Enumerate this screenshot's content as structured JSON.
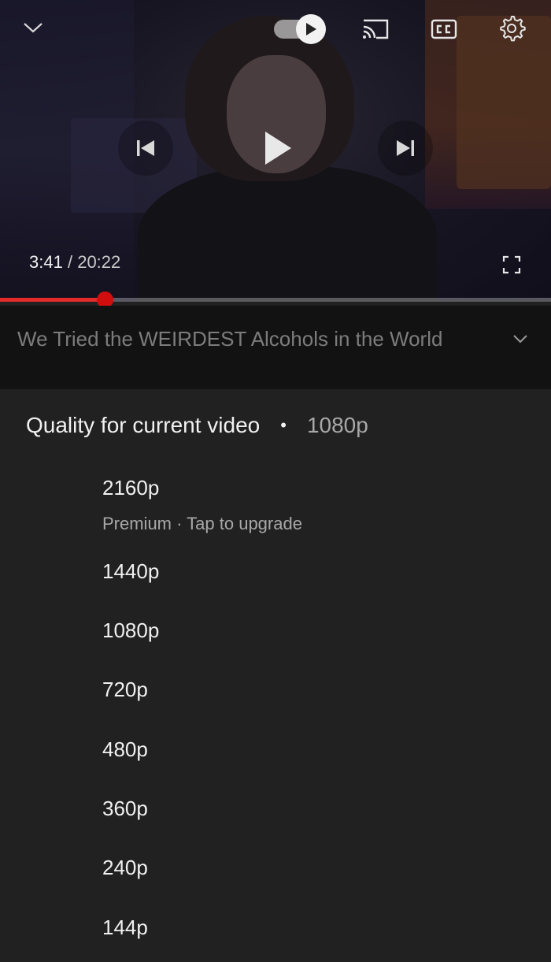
{
  "player": {
    "current_time": "3:41",
    "separator": "/",
    "duration": "20:22",
    "progress_fraction": 0.19,
    "autoplay_on": true,
    "icons": {
      "collapse": "chevron-down-icon",
      "autoplay": "autoplay-toggle-icon",
      "cast": "cast-icon",
      "captions": "closed-captions-icon",
      "settings": "gear-icon",
      "previous": "skip-previous-icon",
      "play": "play-icon",
      "next": "skip-next-icon",
      "fullscreen": "fullscreen-icon"
    },
    "colors": {
      "progress": "#e52a2a",
      "scrubber": "#d10e0e"
    }
  },
  "video": {
    "title": "We Tried the WEIRDEST Alcohols in the World"
  },
  "quality": {
    "header_label": "Quality for current video",
    "header_dot": "•",
    "current": "1080p",
    "options": [
      {
        "label": "2160p",
        "sub": "Premium · Tap to upgrade"
      },
      {
        "label": "1440p"
      },
      {
        "label": "1080p"
      },
      {
        "label": "720p"
      },
      {
        "label": "480p"
      },
      {
        "label": "360p"
      },
      {
        "label": "240p"
      },
      {
        "label": "144p"
      }
    ]
  }
}
